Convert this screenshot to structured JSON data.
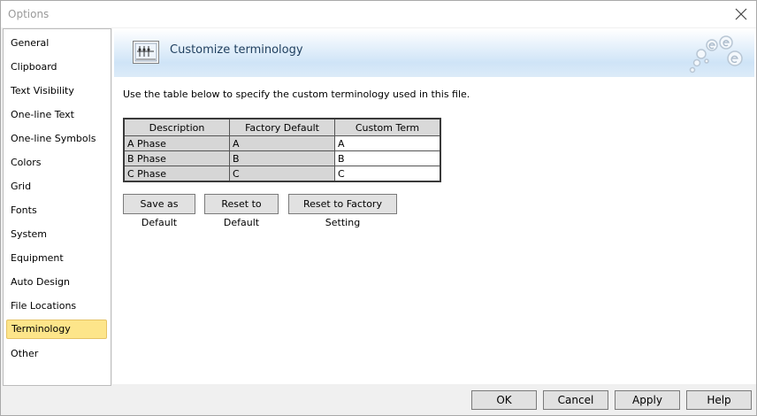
{
  "window": {
    "title": "Options"
  },
  "sidebar": {
    "items": [
      {
        "label": "General"
      },
      {
        "label": "Clipboard"
      },
      {
        "label": "Text Visibility"
      },
      {
        "label": "One-line Text"
      },
      {
        "label": "One-line Symbols"
      },
      {
        "label": "Colors"
      },
      {
        "label": "Grid"
      },
      {
        "label": "Fonts"
      },
      {
        "label": "System"
      },
      {
        "label": "Equipment"
      },
      {
        "label": "Auto Design"
      },
      {
        "label": "File Locations"
      },
      {
        "label": "Terminology",
        "selected": true
      },
      {
        "label": "Other"
      }
    ]
  },
  "main": {
    "title": "Customize terminology",
    "instruction": "Use the table below to specify the custom terminology used in this file.",
    "table": {
      "headers": [
        "Description",
        "Factory Default",
        "Custom Term"
      ],
      "rows": [
        [
          "A Phase",
          "A",
          "A"
        ],
        [
          "B Phase",
          "B",
          "B"
        ],
        [
          "C Phase",
          "C",
          "C"
        ]
      ]
    },
    "buttons": {
      "save_default": "Save as Default",
      "reset_default": "Reset to Default",
      "reset_factory": "Reset to Factory Setting"
    }
  },
  "footer": {
    "ok": "OK",
    "cancel": "Cancel",
    "apply": "Apply",
    "help": "Help"
  },
  "colors": {
    "selected_bg": "#fde58a",
    "banner_blue": "#cfe4f7",
    "title_text": "#1e3e5e"
  }
}
